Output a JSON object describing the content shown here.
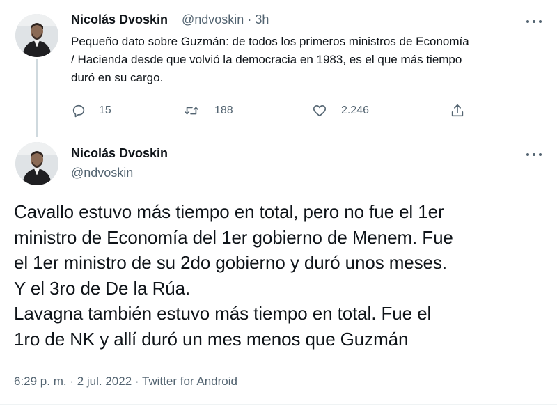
{
  "reply_tweet": {
    "author_name": "Nicolás Dvoskin",
    "author_handle": "@ndvoskin",
    "separator": "·",
    "time": "3h",
    "text": "Pequeño dato sobre Guzmán: de todos los primeros ministros de Economía\n/ Hacienda desde que volvió la democracia en 1983, es el que más tiempo\nduró en su cargo.",
    "replies_count": "15",
    "retweets_count": "188",
    "likes_count": "2.246",
    "icons": [
      "reply-icon",
      "retweet-icon",
      "like-icon",
      "share-icon",
      "more-icon"
    ]
  },
  "main_tweet": {
    "author_name": "Nicolás Dvoskin",
    "author_handle": "@ndvoskin",
    "text": "Cavallo estuvo más tiempo en total, pero no fue el 1er\nministro de Economía del 1er gobierno de Menem. Fue\nel 1er ministro de su 2do gobierno y duró unos meses.\nY el 3ro de De la Rúa.\nLavagna también estuvo más tiempo en total. Fue el\n1ro de NK y allí duró un mes menos que Guzmán",
    "timestamp": "6:29 p. m. · 2 jul. 2022 · Twitter for Android"
  },
  "colors": {
    "text_primary": "#0f1419",
    "text_secondary": "#536471",
    "thread_line": "#cfd9de"
  }
}
